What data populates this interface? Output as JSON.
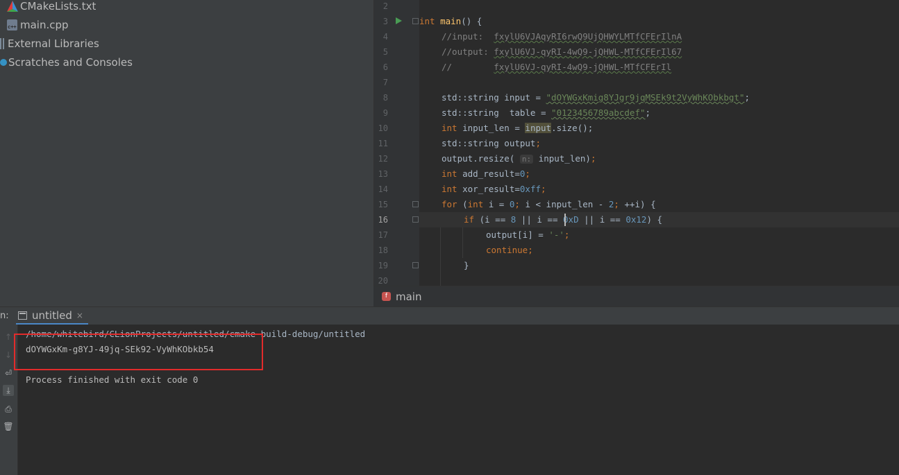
{
  "project_tree": {
    "items": [
      {
        "label": "CMakeLists.txt",
        "icon": "cmake-icon"
      },
      {
        "label": "main.cpp",
        "icon": "cpp-file-icon"
      },
      {
        "label": "External Libraries",
        "icon": "library-icon"
      },
      {
        "label": "Scratches and Consoles",
        "icon": "scratches-icon"
      }
    ]
  },
  "editor": {
    "line_numbers": [
      "2",
      "3",
      "4",
      "5",
      "6",
      "7",
      "8",
      "9",
      "10",
      "11",
      "12",
      "13",
      "14",
      "15",
      "16",
      "17",
      "18",
      "19",
      "20"
    ],
    "current_line": "16",
    "comments": {
      "l4_prefix": "//input:  ",
      "l4_text": "fxylU6VJAqyRI6rwQ9UjQHWYLMTfCFErIlnA",
      "l5_prefix": "//output: ",
      "l5_text": "fxylU6VJ-qyRI-4wQ9-jQHWL-MTfCFErIl67",
      "l6_prefix": "//        ",
      "l6_text": "fxylU6VJ-qyRI-4wQ9-jQHWL-MTfCFErIl"
    },
    "strings": {
      "input": "\"dOYWGxKmig8YJgr9jqMSEk9t2VyWhKObkbgt\"",
      "table": "\"0123456789abcdef\"",
      "dash": "'-'"
    },
    "hints": {
      "resize_param": "n:"
    },
    "numbers": {
      "zero": "0",
      "xff": "0xff",
      "two": "2",
      "eight": "8",
      "hex_d": "0xD",
      "hex_12": "0x12"
    }
  },
  "breadcrumb": {
    "badge": "f",
    "function": "main"
  },
  "run_window": {
    "tool_label": "n:",
    "tab_label": "untitled",
    "tab_close": "×",
    "console": {
      "command": "/home/whitebird/CLionProjects/untitled/cmake-build-debug/untitled",
      "output": "dOYWGxKm-g8YJ-49jq-SEk92-VyWhKObkb54",
      "status": "Process finished with exit code 0"
    }
  },
  "colors": {
    "keyword": "#cc7832",
    "function": "#ffc66d",
    "comment": "#808080",
    "string": "#6a8759",
    "number": "#6897bb",
    "highlight_box": "#e22b2b"
  }
}
